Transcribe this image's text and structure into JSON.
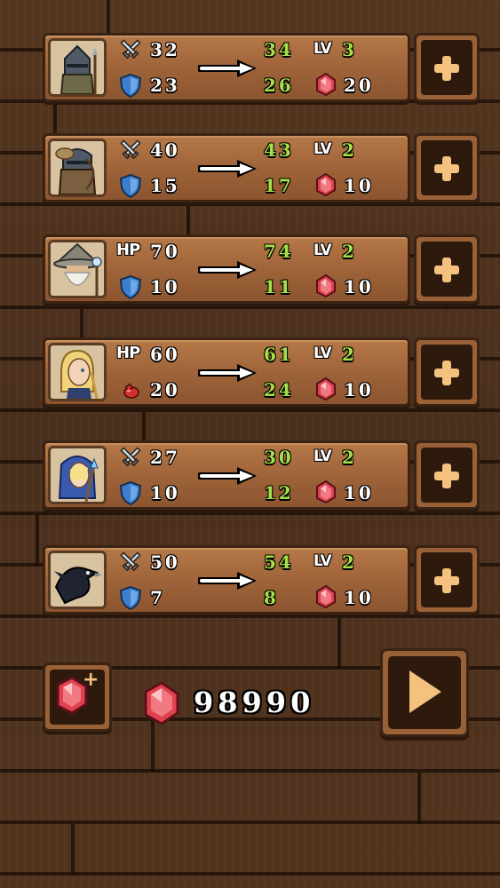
{
  "heroes": [
    {
      "portrait": "knight-portrait",
      "stat1_type": "attack",
      "stat1": "32",
      "stat1_new": "34",
      "stat2_type": "defense",
      "stat2": "23",
      "stat2_new": "26",
      "level_label": "LV",
      "level": "3",
      "cost": "20"
    },
    {
      "portrait": "archer-portrait",
      "stat1_type": "attack",
      "stat1": "40",
      "stat1_new": "43",
      "stat2_type": "defense",
      "stat2": "15",
      "stat2_new": "17",
      "level_label": "LV",
      "level": "2",
      "cost": "10"
    },
    {
      "portrait": "wizard-portrait",
      "stat1_type": "hp",
      "stat1_label": "HP",
      "stat1": "70",
      "stat1_new": "74",
      "stat2_type": "defense",
      "stat2": "10",
      "stat2_new": "11",
      "level_label": "LV",
      "level": "2",
      "cost": "10"
    },
    {
      "portrait": "healer-portrait",
      "stat1_type": "hp",
      "stat1_label": "HP",
      "stat1": "60",
      "stat1_new": "61",
      "stat2_type": "potion",
      "stat2": "20",
      "stat2_new": "24",
      "level_label": "LV",
      "level": "2",
      "cost": "10"
    },
    {
      "portrait": "mage-portrait",
      "stat1_type": "attack",
      "stat1": "27",
      "stat1_new": "30",
      "stat2_type": "defense",
      "stat2": "10",
      "stat2_new": "12",
      "level_label": "LV",
      "level": "2",
      "cost": "10"
    },
    {
      "portrait": "crow-portrait",
      "stat1_type": "attack",
      "stat1": "50",
      "stat1_new": "54",
      "stat2_type": "defense",
      "stat2": "7",
      "stat2_new": "8",
      "level_label": "LV",
      "level": "2",
      "cost": "10"
    }
  ],
  "footer": {
    "gem_total": "98990",
    "buy_gems_icon": "gem-plus-icon",
    "play_icon": "play-icon"
  },
  "colors": {
    "new_value": "#a4e04a",
    "button_plus": "#f4c27e",
    "gem": "#e0414f"
  }
}
